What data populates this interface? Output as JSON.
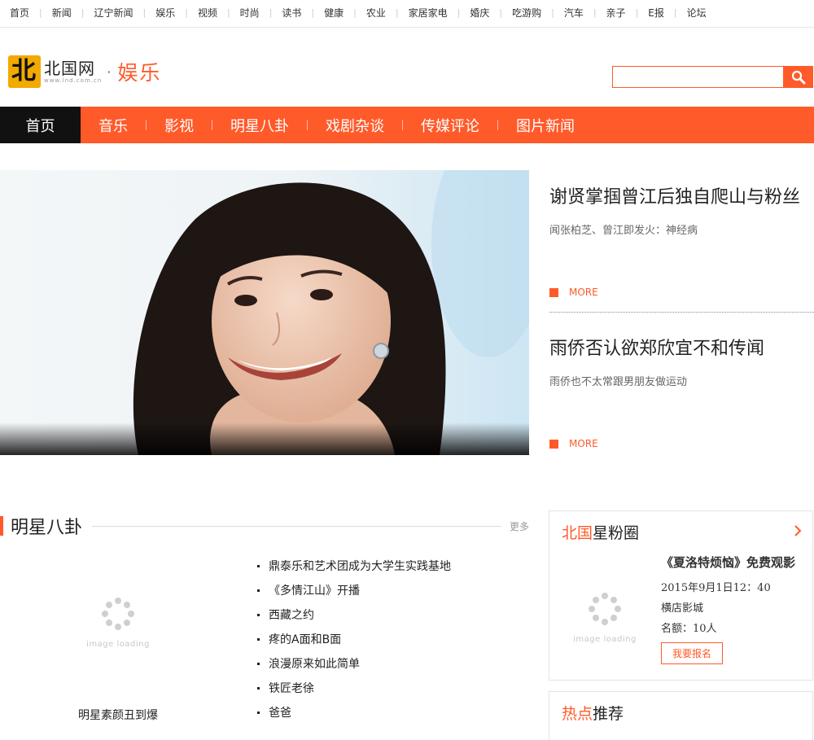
{
  "topnav": [
    "首页",
    "新闻",
    "辽宁新闻",
    "娱乐",
    "视频",
    "时尚",
    "读书",
    "健康",
    "农业",
    "家居家电",
    "婚庆",
    "吃游购",
    "汽车",
    "亲子",
    "E报",
    "论坛"
  ],
  "logo": {
    "brand": "北国网",
    "url": "www.lnd.com.cn",
    "channel": "娱乐",
    "dot": "·"
  },
  "search": {
    "placeholder": "",
    "value": ""
  },
  "channel_nav": {
    "home": "首页",
    "items": [
      "音乐",
      "影视",
      "明星八卦",
      "戏剧杂谈",
      "传媒评论",
      "图片新闻"
    ]
  },
  "hero": {
    "stories": [
      {
        "title": "谢贤掌掴曾江后独自爬山与粉丝",
        "summary": "闻张柏芝、曾江即发火：神经病",
        "more": "MORE"
      },
      {
        "title": "雨侨否认欲郑欣宜不和传闻",
        "summary": "雨侨也不太常跟男朋友做运动",
        "more": "MORE"
      }
    ]
  },
  "gossip": {
    "title": "明星八卦",
    "more": "更多",
    "loading_text": "image loading",
    "featured_caption": "明星素颜丑到爆",
    "list": [
      "鼎泰乐和艺术团成为大学生实践基地",
      "《多情江山》开播",
      "西藏之约",
      "疼的A面和B面",
      "浪漫原来如此简单",
      "铁匠老徐",
      "爸爸"
    ]
  },
  "fans": {
    "title_hl": "北国",
    "title_rest": "星粉圈",
    "loading_text": "image loading",
    "event_title": "《夏洛特烦恼》免费观影",
    "time": "2015年9月1日12：40",
    "place": "横店影城",
    "quota": "名额：10人",
    "signup": "我要报名"
  },
  "hot": {
    "title_hl": "热点",
    "title_rest": "推荐"
  },
  "colors": {
    "accent": "#ff5a2a",
    "nav_home_bg": "#111111",
    "text": "#333333"
  },
  "icons": [
    "search-icon",
    "chevron-right-icon",
    "loading-spinner-icon"
  ]
}
